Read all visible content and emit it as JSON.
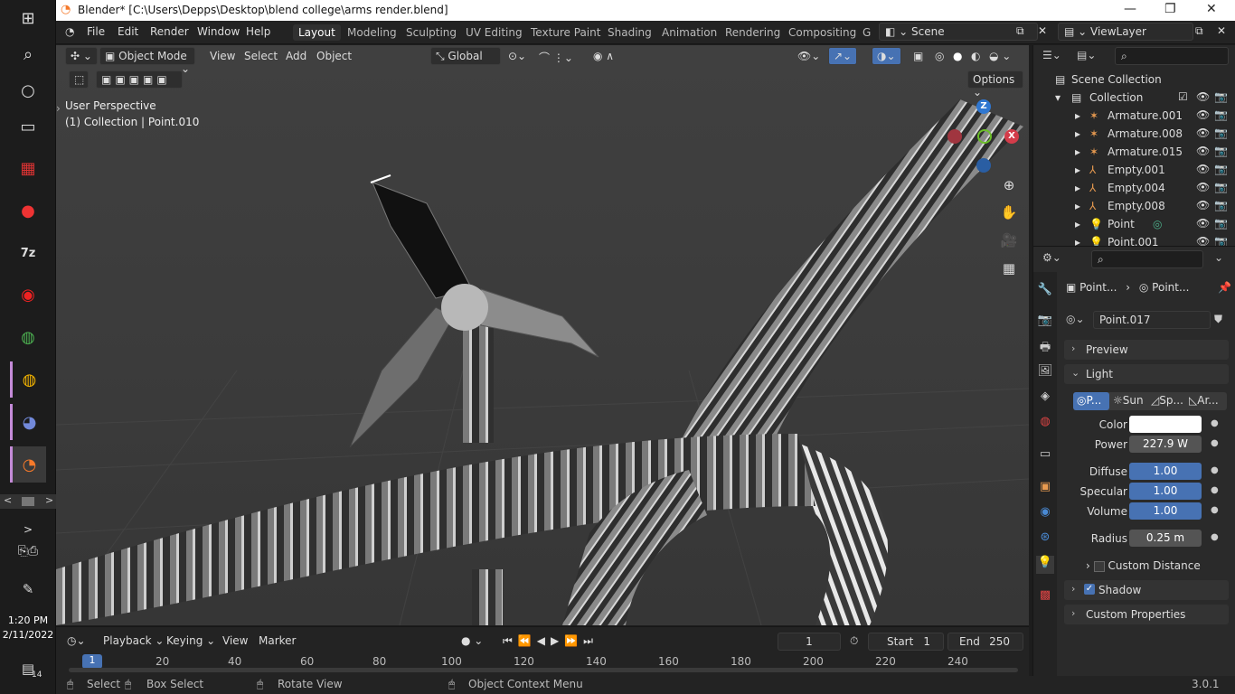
{
  "window": {
    "title": "Blender* [C:\\Users\\Depps\\Desktop\\blend college\\arms render.blend]"
  },
  "taskbar": {
    "time": "1:20 PM",
    "date": "2/11/2022",
    "notification_count": "14",
    "icons": [
      "windows-start-icon",
      "search-icon",
      "cortana-icon",
      "task-view-icon",
      "winrar-icon",
      "record-app-icon",
      "7zip-icon",
      "screen-recorder-icon",
      "chrome-icon",
      "chrome-canary-icon",
      "discord-icon",
      "blender-icon"
    ]
  },
  "menubar": {
    "items": [
      "File",
      "Edit",
      "Render",
      "Window",
      "Help"
    ],
    "workspaces": [
      "Layout",
      "Modeling",
      "Sculpting",
      "UV Editing",
      "Texture Paint",
      "Shading",
      "Animation",
      "Rendering",
      "Compositing",
      "G"
    ],
    "active_workspace": "Layout",
    "scene": "Scene",
    "view_layer": "ViewLayer"
  },
  "viewport": {
    "mode": "Object Mode",
    "menus": [
      "View",
      "Select",
      "Add",
      "Object"
    ],
    "orientation": "Global",
    "options_label": "Options",
    "perspective_label": "User Perspective",
    "context_label": "(1) Collection | Point.010",
    "gizmo": {
      "z": "Z",
      "y": "Y",
      "x": "X"
    }
  },
  "timeline": {
    "menus": [
      "Playback",
      "Keying",
      "View",
      "Marker"
    ],
    "current_frame": "1",
    "start_label": "Start",
    "start": "1",
    "end_label": "End",
    "end": "250",
    "ruler": [
      "1",
      "20",
      "40",
      "60",
      "80",
      "100",
      "120",
      "140",
      "160",
      "180",
      "200",
      "220",
      "240"
    ]
  },
  "statusbar": {
    "select": "Select",
    "box_select": "Box Select",
    "rotate_view": "Rotate View",
    "context_menu": "Object Context Menu",
    "version": "3.0.1"
  },
  "outliner": {
    "scene_collection": "Scene Collection",
    "collection": "Collection",
    "items": [
      {
        "name": "Armature.001",
        "icon": "armature-icon"
      },
      {
        "name": "Armature.008",
        "icon": "armature-icon"
      },
      {
        "name": "Armature.015",
        "icon": "armature-icon"
      },
      {
        "name": "Empty.001",
        "icon": "empty-icon"
      },
      {
        "name": "Empty.004",
        "icon": "empty-icon"
      },
      {
        "name": "Empty.008",
        "icon": "empty-icon"
      },
      {
        "name": "Point",
        "icon": "light-icon"
      },
      {
        "name": "Point.001",
        "icon": "light-icon"
      }
    ]
  },
  "properties": {
    "breadcrumb_object": "Point...",
    "breadcrumb_data": "Point...",
    "datablock": "Point.017",
    "panels": {
      "preview": "Preview",
      "light": "Light",
      "shadow": "Shadow",
      "custom_properties": "Custom Properties"
    },
    "light_types": [
      "P...",
      "Sun",
      "Sp...",
      "Ar..."
    ],
    "fields": {
      "color_label": "Color",
      "power_label": "Power",
      "power": "227.9 W",
      "diffuse_label": "Diffuse",
      "diffuse": "1.00",
      "specular_label": "Specular",
      "specular": "1.00",
      "volume_label": "Volume",
      "volume": "1.00",
      "radius_label": "Radius",
      "radius": "0.25 m",
      "custom_distance_label": "Custom Distance"
    },
    "colors": {
      "light_color": "#ffffff",
      "accent": "#4772b3"
    }
  }
}
